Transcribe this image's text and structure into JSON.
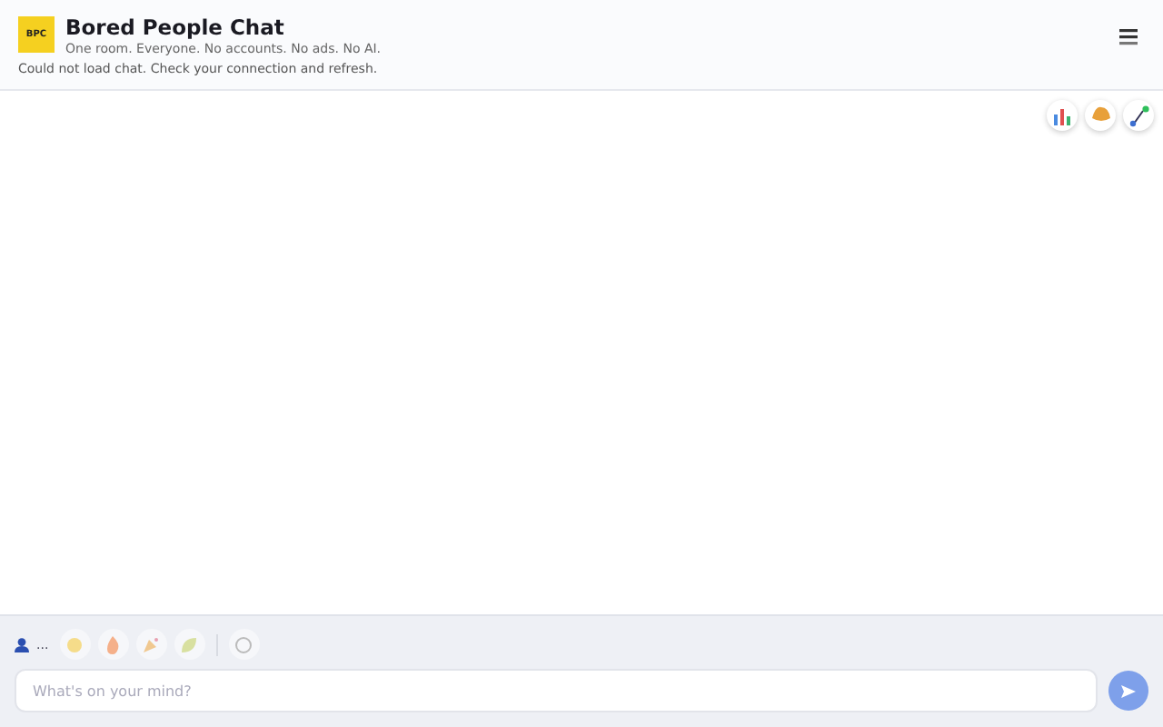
{
  "header": {
    "logo": "BPC",
    "title": "Bored People Chat",
    "tagline": "One room. Everyone. No accounts. No ads. No AI.",
    "error": "Could not load chat. Check your connection and refresh."
  },
  "composer": {
    "online_count": "...",
    "placeholder": "What's on your mind?"
  }
}
